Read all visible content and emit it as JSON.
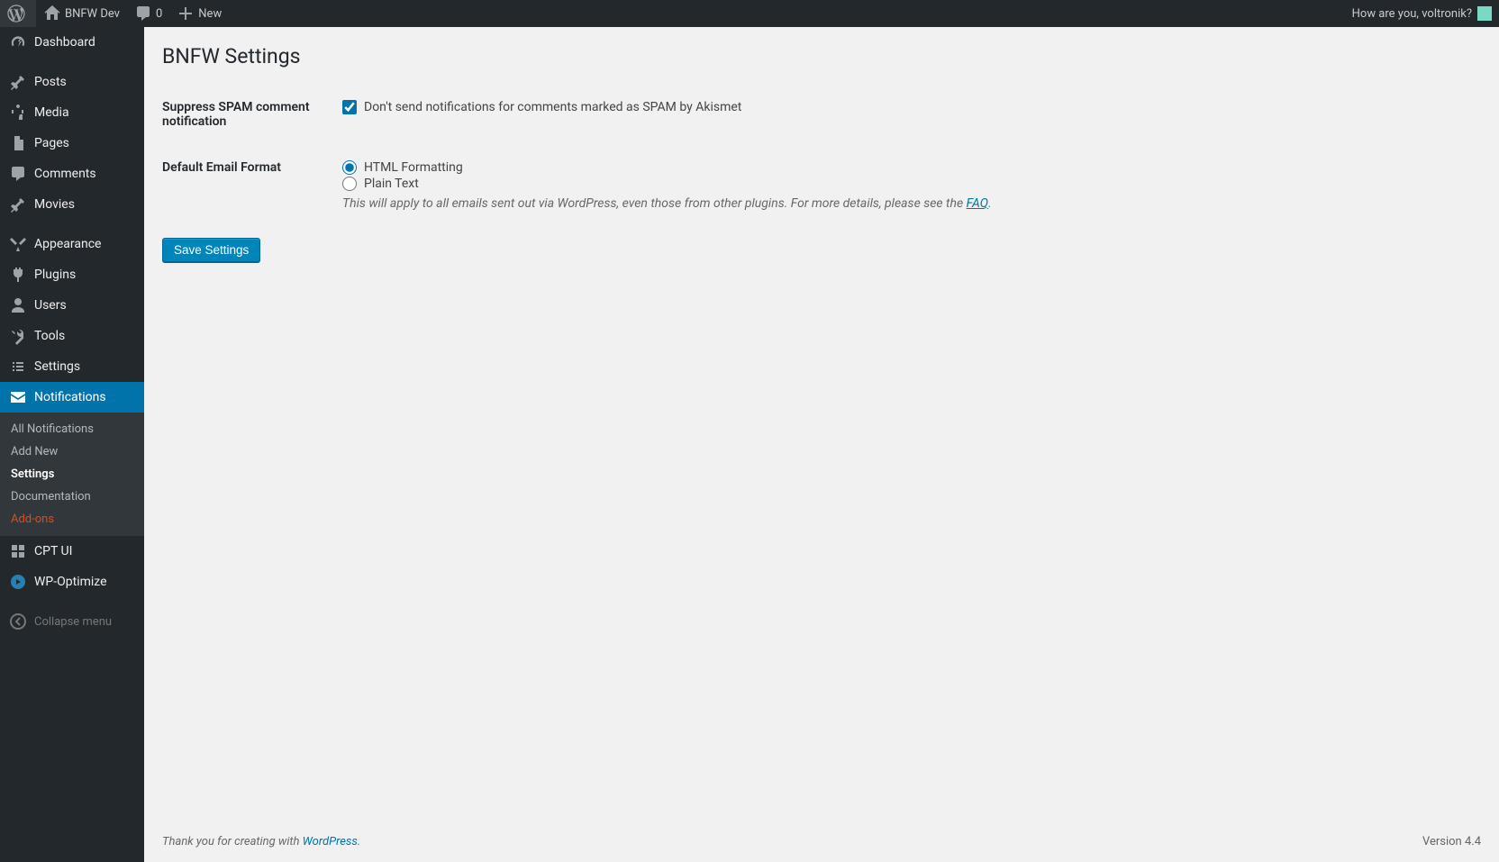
{
  "adminbar": {
    "site_name": "BNFW Dev",
    "comment_count": "0",
    "new_label": "New",
    "greeting": "How are you, voltronik?"
  },
  "sidebar": {
    "items": [
      {
        "label": "Dashboard",
        "icon": "dashboard"
      },
      {
        "label": "Posts",
        "icon": "pin"
      },
      {
        "label": "Media",
        "icon": "media"
      },
      {
        "label": "Pages",
        "icon": "page"
      },
      {
        "label": "Comments",
        "icon": "comment"
      },
      {
        "label": "Movies",
        "icon": "pin"
      },
      {
        "label": "Appearance",
        "icon": "appearance"
      },
      {
        "label": "Plugins",
        "icon": "plugin"
      },
      {
        "label": "Users",
        "icon": "user"
      },
      {
        "label": "Tools",
        "icon": "tools"
      },
      {
        "label": "Settings",
        "icon": "settings"
      },
      {
        "label": "Notifications",
        "icon": "mail"
      },
      {
        "label": "CPT UI",
        "icon": "cptui"
      },
      {
        "label": "WP-Optimize",
        "icon": "wpoptimize"
      }
    ],
    "submenu": [
      "All Notifications",
      "Add New",
      "Settings",
      "Documentation",
      "Add-ons"
    ],
    "collapse_label": "Collapse menu"
  },
  "page": {
    "title": "BNFW Settings",
    "row1_label": "Suppress SPAM comment notification",
    "row1_checkbox_label": "Don't send notifications for comments marked as SPAM by Akismet",
    "row2_label": "Default Email Format",
    "radio_html": "HTML Formatting",
    "radio_plain": "Plain Text",
    "note_prefix": "This will apply to all emails sent out via WordPress, even those from other plugins. For more details, please see the ",
    "note_link": "FAQ",
    "note_suffix": ".",
    "save_button": "Save Settings"
  },
  "footer": {
    "thanks_prefix": "Thank you for creating with ",
    "wp_link": "WordPress",
    "thanks_suffix": ".",
    "version": "Version 4.4"
  }
}
